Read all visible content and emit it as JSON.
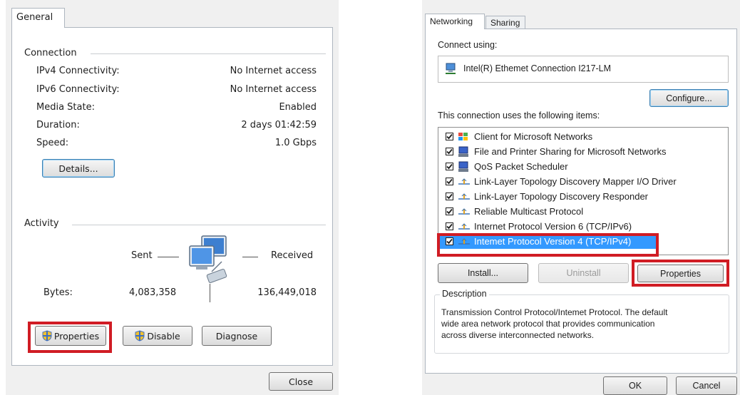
{
  "left": {
    "tab_general": "General",
    "connection": {
      "heading": "Connection",
      "rows": [
        {
          "label": "IPv4 Connectivity:",
          "value": "No Internet access"
        },
        {
          "label": "IPv6 Connectivity:",
          "value": "No Internet access"
        },
        {
          "label": "Media State:",
          "value": "Enabled"
        },
        {
          "label": "Duration:",
          "value": "2 days 01:42:59"
        },
        {
          "label": "Speed:",
          "value": "1.0 Gbps"
        }
      ],
      "details_button": "Details..."
    },
    "activity": {
      "heading": "Activity",
      "sent": "Sent",
      "received": "Received",
      "bytes_label": "Bytes:",
      "bytes_sent": "4,083,358",
      "bytes_received": "136,449,018"
    },
    "buttons": {
      "properties": "Properties",
      "disable": "Disable",
      "diagnose": "Diagnose",
      "close": "Close"
    }
  },
  "right": {
    "tabs": {
      "networking": "Networking",
      "sharing": "Sharing"
    },
    "connect_using_label": "Connect using:",
    "adapter_name": "Intel(R) Ethemet Connection I217-LM",
    "configure_button": "Configure...",
    "items_label": "This connection uses the following items:",
    "items": [
      {
        "label": "Client for Microsoft Networks",
        "icon": "network-client-icon",
        "checked": true
      },
      {
        "label": "File and Printer Sharing for Microsoft Networks",
        "icon": "computer-icon",
        "checked": true
      },
      {
        "label": "QoS Packet Scheduler",
        "icon": "computer-icon",
        "checked": true
      },
      {
        "label": "Link-Layer Topology Discovery Mapper I/O Driver",
        "icon": "protocol-icon",
        "checked": true
      },
      {
        "label": "Link-Layer Topology Discovery Responder",
        "icon": "protocol-icon",
        "checked": true
      },
      {
        "label": "Reliable Multicast Protocol",
        "icon": "protocol-icon",
        "checked": true
      },
      {
        "label": "Internet Protocol Version 6 (TCP/IPv6)",
        "icon": "protocol-icon",
        "checked": true
      },
      {
        "label": "Intemet Protocol Version 4 (TCP/IPv4)",
        "icon": "protocol-icon",
        "checked": true,
        "selected": true
      }
    ],
    "buttons": {
      "install": "Install...",
      "uninstall": "Uninstall",
      "properties": "Properties",
      "ok": "OK",
      "cancel": "Cancel"
    },
    "description": {
      "heading": "Description",
      "line1": "Transmission Control Protocol/Intemet Protocol. The default",
      "line2": "wide area network protocol that provides communication",
      "line3": "across diverse interconnected networks."
    }
  },
  "colors": {
    "highlight_red": "#d01c24",
    "selection_blue": "#3399ff",
    "dialog_bg": "#f0f0f0"
  }
}
